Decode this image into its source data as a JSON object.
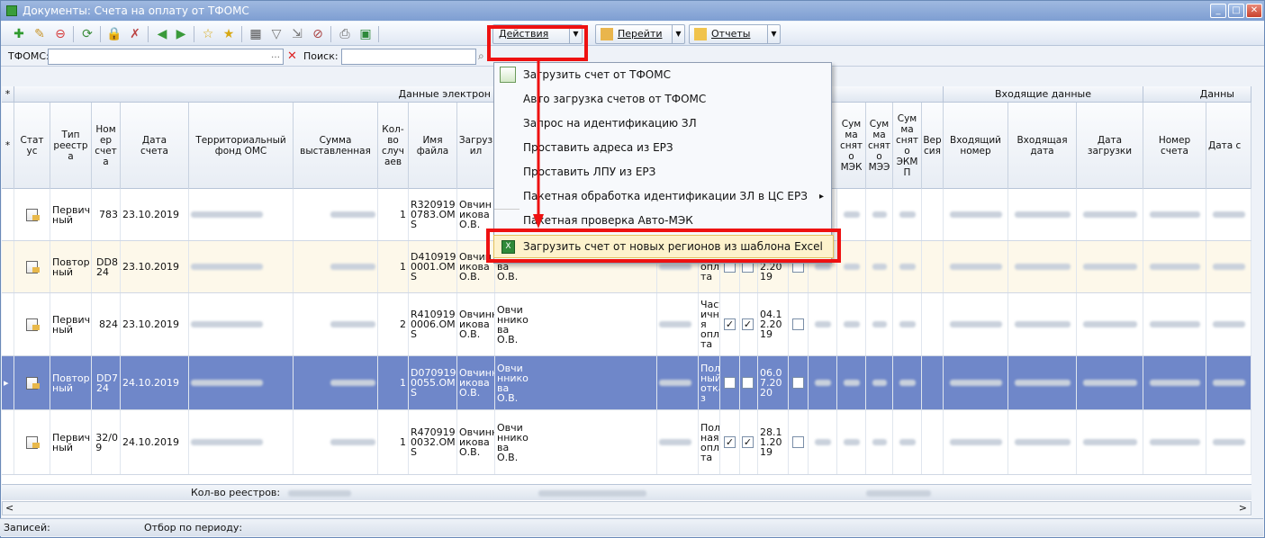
{
  "window": {
    "title": "Документы: Счета на оплату от ТФОМС",
    "min": "_",
    "max": "□",
    "close": "✕"
  },
  "toolbar": {
    "actions_label": "Действия",
    "goto_label": "Перейти",
    "reports_label": "Отчеты"
  },
  "filter": {
    "tfoms_label": "ТФОМС:",
    "search_label": "Поиск:",
    "tfoms_value": "",
    "search_value": ""
  },
  "groups": {
    "electronic": "Данные электрон",
    "incoming": "Входящие данные",
    "data_c": "Данны"
  },
  "columns": {
    "status": "Стат\nус",
    "registry_type": "Тип\nреестр\nа",
    "account_no": "Ном\nер\nсчет\nа",
    "account_date": "Дата\nсчета",
    "fund": "Территориальный\nфонд ОМС",
    "amount": "Сумма\nвыставленная",
    "cases": "Кол-\nво\nслуч\nаев",
    "file_name": "Имя\nфайла",
    "loaded_by": "Загруз\nил",
    "sum_mek": "Сум\nма\nснят\nо\nМЭК",
    "sum_mee": "Сум\nма\nснят\nо\nМЭЭ",
    "sum_ekmp": "Сум\nма\nснят\nо\nЭКМ\nП",
    "version": "Вер\nсия",
    "incoming_no": "Входящий\nномер",
    "incoming_date": "Входящая\nдата",
    "load_date": "Дата\nзагрузки",
    "invoice_no": "Номер\nсчета",
    "date_c": "Дата с"
  },
  "rows": [
    {
      "type": "Первич\nный",
      "no": "783",
      "date": "23.10.2019",
      "cases": "1",
      "file": "R320919\n0783.OM\nS",
      "by": "Овчин\nикова\nО.В.",
      "loaded": "",
      "pay": "",
      "c1": false,
      "c2": false,
      "pdate": "",
      "selected": false
    },
    {
      "type": "Повтор\nный",
      "no": "DD8\n24",
      "date": "23.10.2019",
      "cases": "1",
      "file": "D410919\n0001.OM\nS",
      "by": "Овчин\nикова\nО.В.",
      "loaded": "нико\nва\nО.В.",
      "pay": "ная\nопла\nта",
      "c1": false,
      "c2": false,
      "pdate": "04.1\n2.20\n19",
      "selected": false
    },
    {
      "type": "Первич\nный",
      "no": "824",
      "date": "23.10.2019",
      "cases": "2",
      "file": "R410919\n0006.OM\nS",
      "by": "Овчинн\nикова\nО.В.",
      "loaded": "Овчи\nннико\nва\nО.В.",
      "pay": "Част\nична\nя\nопла\nта",
      "c1": true,
      "c2": true,
      "pdate": "04.1\n2.20\n19",
      "selected": false
    },
    {
      "type": "Повтор\nный",
      "no": "DD7\n24",
      "date": "24.10.2019",
      "cases": "1",
      "file": "D070919\n0055.OM\nS",
      "by": "Овчинн\nикова\nО.В.",
      "loaded": "Овчи\nннико\nва\nО.В.",
      "pay": "Пол\nный\nотка\nз",
      "c1": false,
      "c2": false,
      "pdate": "06.0\n7.20\n20",
      "selected": true
    },
    {
      "type": "Первич\nный",
      "no": "32/0\n9",
      "date": "24.10.2019",
      "cases": "1",
      "file": "R470919\n0032.OM\nS",
      "by": "Овчинн\nикова\nО.В.",
      "loaded": "Овчи\nннико\nва\nО.В.",
      "pay": "Пол\nная\nопла\nта",
      "c1": true,
      "c2": true,
      "pdate": "28.1\n1.20\n19",
      "selected": false
    }
  ],
  "footer": {
    "count_label": "Кол-во реестров:"
  },
  "status": {
    "records_label": "Записей:",
    "period_label": "Отбор по периоду:"
  },
  "menu": {
    "items": [
      "Загрузить счет от ТФОМС",
      "Авто загрузка счетов от ТФОМС",
      "Запрос на идентификацию ЗЛ",
      "Проставить адреса из ЕРЗ",
      "Проставить ЛПУ из ЕРЗ",
      "Пакетная обработка идентификации ЗЛ в ЦС ЕРЗ",
      "Пакетная проверка Авто-МЭК"
    ],
    "highlighted": "Загрузить счет от новых регионов из шаблона Excel"
  },
  "colors": {
    "selected_row": "#6f87c9",
    "highlight_border": "#e11111",
    "alt_row": "#fdf8ea"
  }
}
